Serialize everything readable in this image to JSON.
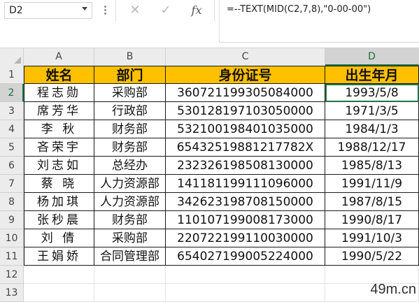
{
  "name_box": "D2",
  "formula": "=--TEXT(MID(C2,7,8),\"0-00-00\")",
  "toolbar": {
    "cancel_glyph": "✕",
    "confirm_glyph": "✓",
    "fx_label": "fx"
  },
  "columns": [
    "A",
    "B",
    "C",
    "D"
  ],
  "header": {
    "name": "姓名",
    "dept": "部门",
    "id": "身份证号",
    "birth": "出生年月"
  },
  "rows": [
    {
      "name": "程志勋",
      "dept": "采购部",
      "id": "360721199305084000",
      "birth": "1993/5/8"
    },
    {
      "name": "席芳华",
      "dept": "行政部",
      "id": "530128197103050000",
      "birth": "1971/3/5"
    },
    {
      "name": "李 秋",
      "dept": "财务部",
      "id": "532100198401035000",
      "birth": "1984/1/3"
    },
    {
      "name": "吝荣宇",
      "dept": "财务部",
      "id": "65432519881217782X",
      "birth": "1988/12/17"
    },
    {
      "name": "刘志如",
      "dept": "总经办",
      "id": "232326198508130000",
      "birth": "1985/8/13"
    },
    {
      "name": "蔡 晓",
      "dept": "人力资源部",
      "id": "141181199111096000",
      "birth": "1991/11/9"
    },
    {
      "name": "杨加琪",
      "dept": "人力资源部",
      "id": "342623198708150000",
      "birth": "1987/8/15"
    },
    {
      "name": "张秒晨",
      "dept": "财务部",
      "id": "110107199008173000",
      "birth": "1990/8/17"
    },
    {
      "name": "刘 倩",
      "dept": "采购部",
      "id": "220722199110030000",
      "birth": "1991/10/3"
    },
    {
      "name": "王娟娇",
      "dept": "合同管理部",
      "id": "654027199005224000",
      "birth": "1990/5/22"
    }
  ],
  "row_numbers": [
    "1",
    "2",
    "3",
    "4",
    "5",
    "6",
    "7",
    "8",
    "9",
    "10",
    "11",
    "12",
    "13"
  ],
  "watermark": "49m.cn",
  "colors": {
    "header_fill": "#ffc000",
    "accent": "#217346"
  }
}
